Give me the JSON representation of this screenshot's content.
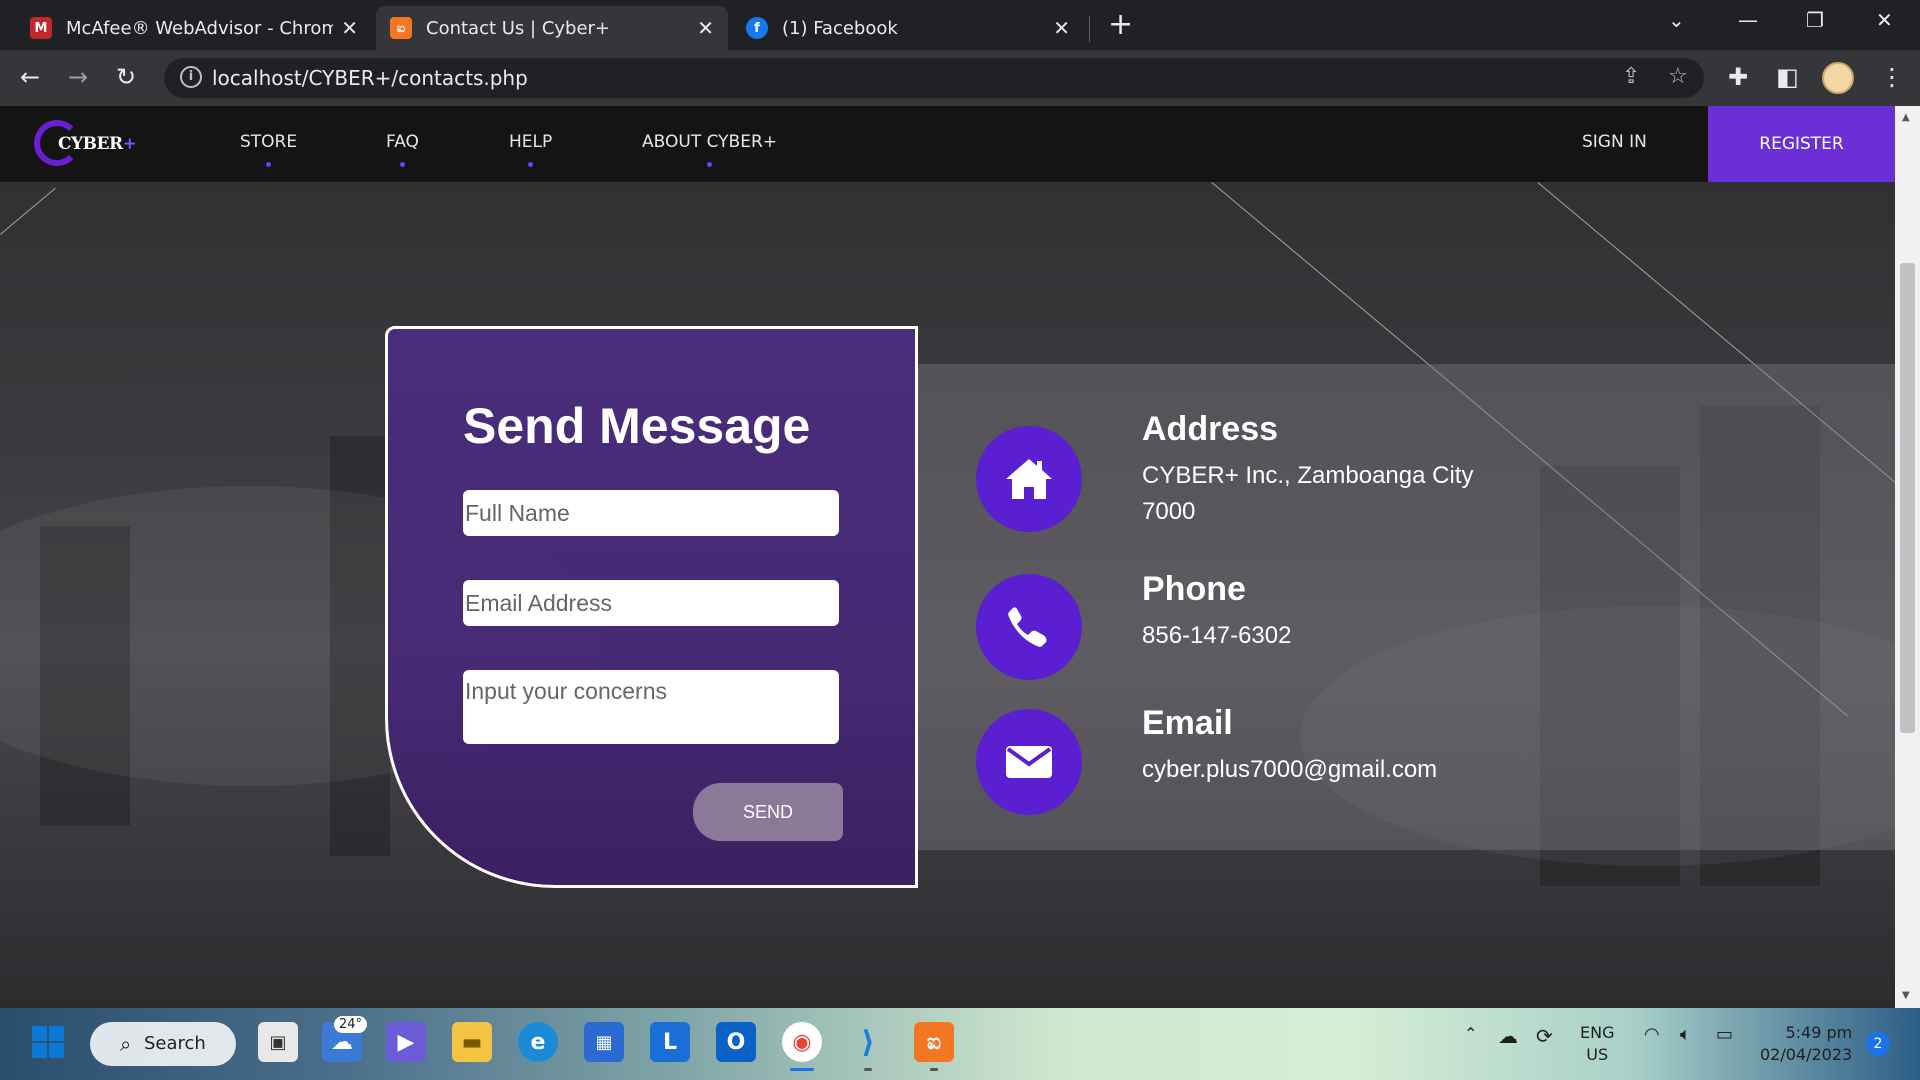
{
  "browser": {
    "tabs": [
      {
        "title": "McAfee® WebAdvisor - Chrome",
        "active": false,
        "icon": "mcafee-icon"
      },
      {
        "title": "Contact Us | Cyber+",
        "active": true,
        "icon": "xampp-icon"
      },
      {
        "title": "(1) Facebook",
        "active": false,
        "icon": "facebook-icon"
      }
    ],
    "url": "localhost/CYBER+/contacts.php"
  },
  "site": {
    "logo_text": "CYBER",
    "logo_plus": "+",
    "nav": [
      "STORE",
      "FAQ",
      "HELP",
      "ABOUT CYBER+"
    ],
    "sign_in": "SIGN IN",
    "register": "REGISTER",
    "accent_color": "#6a2fd6"
  },
  "form": {
    "title": "Send Message",
    "name_placeholder": "Full Name",
    "email_placeholder": "Email Address",
    "concern_placeholder": "Input your concerns",
    "send_label": "SEND"
  },
  "contact": {
    "address_heading": "Address",
    "address_line1": "CYBER+ Inc., Zamboanga City",
    "address_line2": "7000",
    "phone_heading": "Phone",
    "phone_value": "856-147-6302",
    "email_heading": "Email",
    "email_value": "cyber.plus7000@gmail.com"
  },
  "taskbar": {
    "search_label": "Search",
    "weather_temp": "24°",
    "lang_top": "ENG",
    "lang_bottom": "US",
    "time": "5:49 pm",
    "date": "02/04/2023",
    "notification_count": "2"
  }
}
